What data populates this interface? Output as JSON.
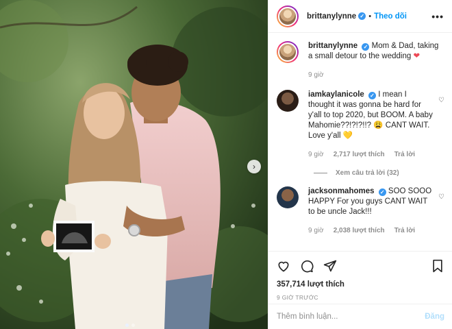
{
  "post": {
    "username": "brittanylynne",
    "follow_label": "Theo dõi",
    "separator": "•",
    "more_label": "•••",
    "caption": "Mom & Dad, taking a small detour to the wedding",
    "caption_emoji": "❤",
    "caption_time": "9 giờ",
    "next_icon": "chevron-right-icon"
  },
  "comments": [
    {
      "username": "iamkaylanicole",
      "text": "I mean I thought it was gonna be hard for y'all to top 2020, but BOOM. A baby Mahomie??!?!?!!? 😩 CANT WAIT. Love y'all 💛",
      "time": "9 giờ",
      "likes": "2,717 lượt thích",
      "reply_label": "Trả lời",
      "view_replies": "Xem câu trả lời (32)"
    },
    {
      "username": "jacksonmahomes",
      "text": "SOO SOOO HAPPY For you guys CANT WAIT to be uncle Jack!!!",
      "time": "9 giờ",
      "likes": "2,038 lượt thích",
      "reply_label": "Trả lời"
    }
  ],
  "footer": {
    "likes": "357,714 lượt thích",
    "time": "9 GIỜ TRƯỚC",
    "comment_placeholder": "Thêm bình luận...",
    "post_label": "Đăng"
  },
  "colors": {
    "link": "#0095f6",
    "verified": "#3897f0",
    "muted": "#8e8e8e",
    "post_disabled": "#b2dffc"
  }
}
